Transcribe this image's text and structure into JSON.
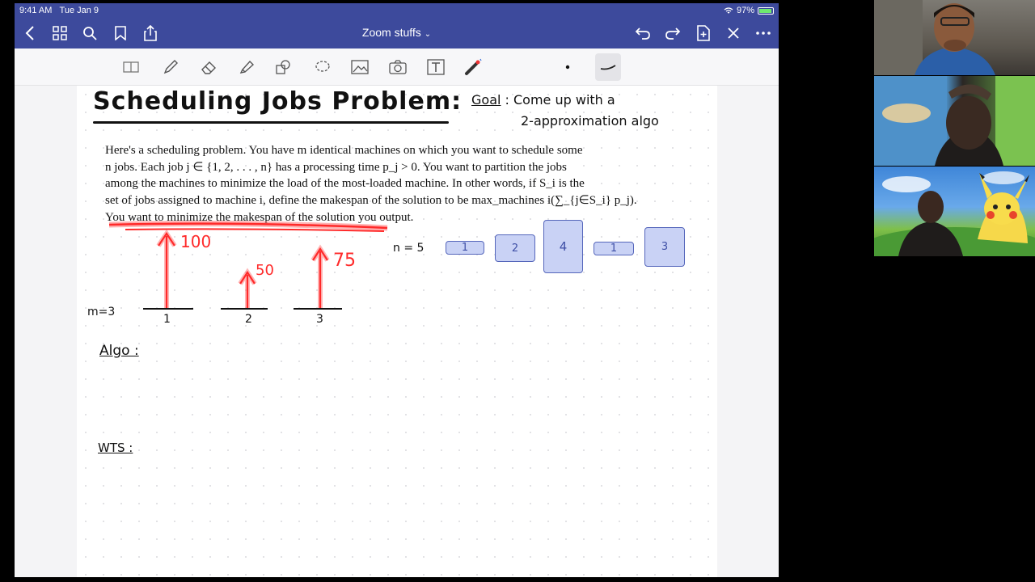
{
  "status": {
    "time": "9:41 AM",
    "date": "Tue Jan 9",
    "battery": "97%"
  },
  "nav": {
    "title": "Zoom stuffs",
    "chevron": "⌄"
  },
  "note": {
    "title": "Scheduling Jobs Problem:",
    "goal_label": "Goal",
    "goal_text_1": ": Come up with a",
    "goal_text_2": "2-approximation algo",
    "paragraph": [
      "Here's a scheduling problem. You have m identical machines on which you want to schedule some",
      "n jobs. Each job j ∈ {1, 2, . . . , n} has a processing time p_j > 0. You want to partition the jobs",
      "among the machines to minimize the load of the most-loaded machine. In other words, if S_i is the",
      "set of jobs assigned to machine i, define the makespan of the solution to be max_machines i(∑_{j∈S_i} p_j).",
      "You want to minimize the makespan of the solution you output."
    ],
    "m_label": "m=3",
    "machines": [
      "1",
      "2",
      "3"
    ],
    "loads": [
      "100",
      "50",
      "75"
    ],
    "n_label": "n = 5",
    "jobs": [
      "1",
      "2",
      "4",
      "1",
      "3"
    ],
    "algo_label": "Algo :",
    "wts_label": "WTS :"
  },
  "colors": {
    "nav": "#3d4a9c",
    "ink_red": "#ff2a2a",
    "job_fill": "#c9d2f5"
  },
  "icons": [
    "back-icon",
    "grid-icon",
    "search-icon",
    "bookmark-icon",
    "share-icon",
    "undo-icon",
    "redo-icon",
    "add-page-icon",
    "close-icon",
    "more-icon"
  ]
}
